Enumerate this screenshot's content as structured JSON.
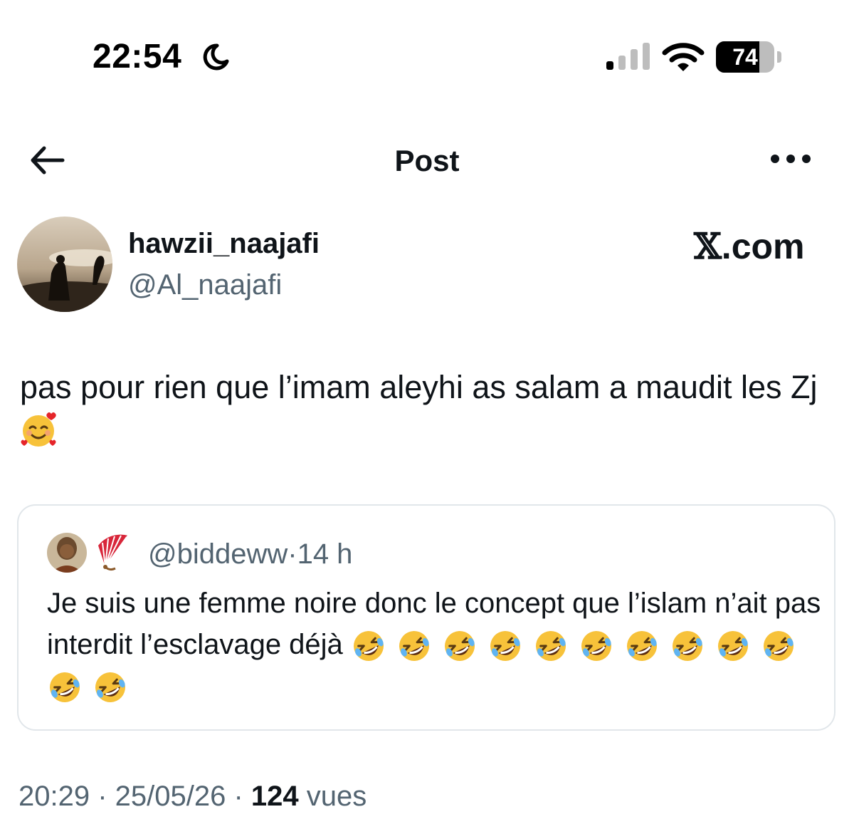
{
  "status_bar": {
    "time": "22:54",
    "battery": "74",
    "battery_level": 0.74
  },
  "nav": {
    "title": "Post"
  },
  "author": {
    "display_name": "hawzii_naajafi",
    "handle": "@Al_naajafi"
  },
  "watermark": {
    "x_glyph": "𝕏",
    "domain": ".com"
  },
  "tweet": {
    "text": "pas pour rien que l’imam aleyhi as salam a maudit les Zj",
    "emoji": "smiling-face-with-hearts"
  },
  "quote": {
    "handle": "@biddeww",
    "separator": "·",
    "time_ago": "14 h",
    "text": "Je suis une femme noire donc le concept que l’islam n’ait pas interdit l’esclavage déjà",
    "emoji": "rolling-on-the-floor-laughing",
    "emoji_count": 12
  },
  "meta": {
    "time": "20:29",
    "sep1": " · ",
    "date": "25/05/26",
    "sep2": " · ",
    "views_count": "124",
    "views_label": " vues"
  },
  "colors": {
    "text": "#0f1419",
    "secondary": "#536471",
    "border": "#e1e6ea",
    "emoji_yellow": "#f7c23a"
  }
}
